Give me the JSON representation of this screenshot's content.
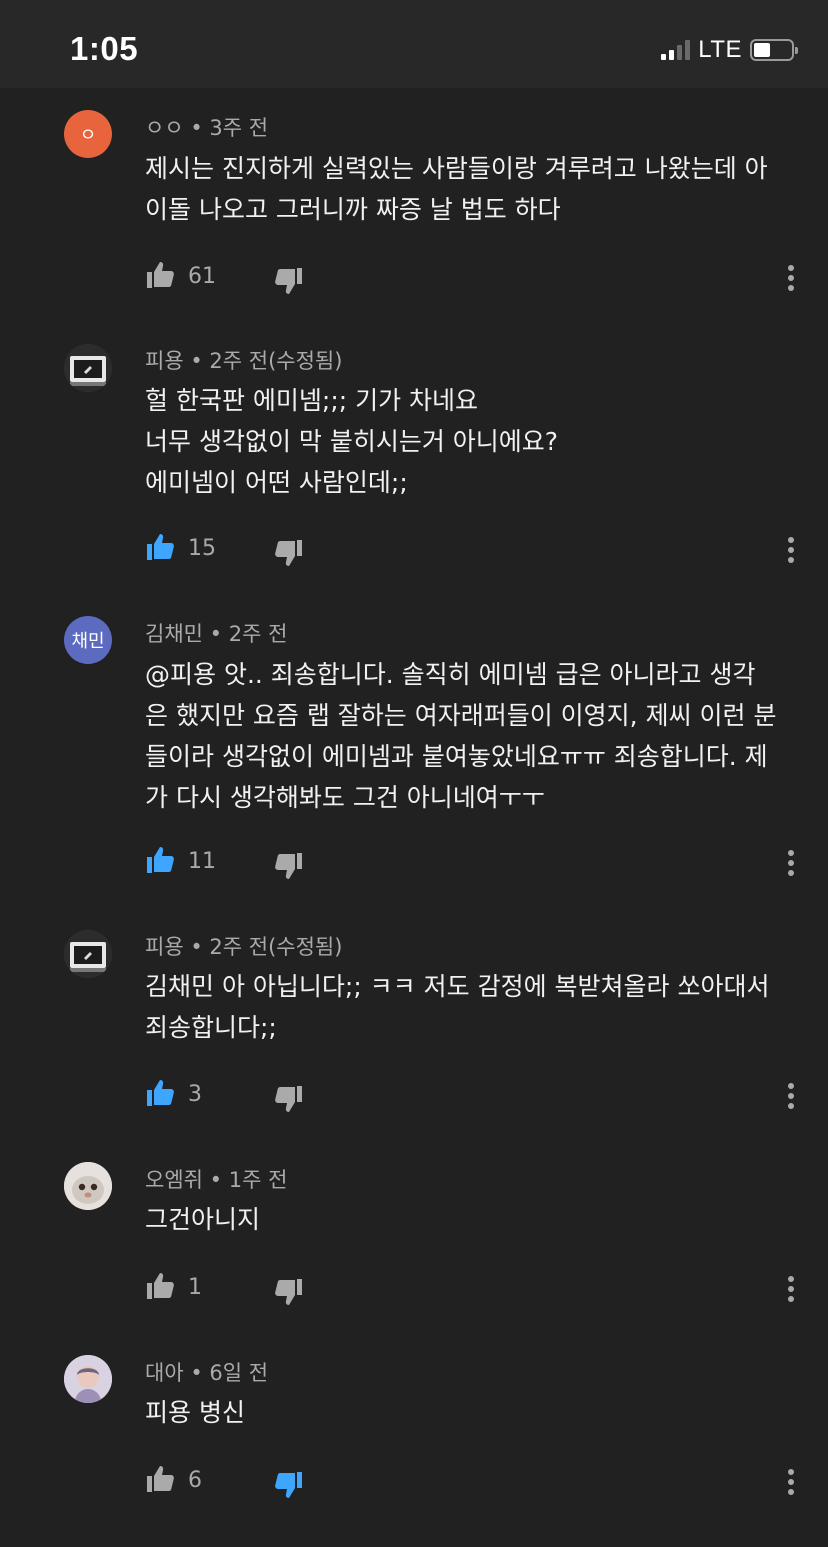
{
  "status": {
    "time": "1:05",
    "network": "LTE"
  },
  "comments": [
    {
      "author": "ㅇㅇ",
      "time": "3주 전",
      "edited": "",
      "avatar_text": "ㅇ",
      "avatar_color": "#e8643c",
      "lines": [
        "제시는 진지하게 실력있는 사람들이랑 겨루려고 나왔는데 아",
        "이돌 나오고 그러니까 짜증 날 법도 하다"
      ],
      "likes": "61",
      "liked": false,
      "disliked": false
    },
    {
      "author": "피용",
      "time": "2주 전",
      "edited": "(수정됨)",
      "avatar_text": "",
      "avatar_color": "#3a3a3a",
      "lines": [
        "헐 한국판 에미넴;;; 기가 차네요",
        "너무 생각없이 막 붙히시는거 아니에요?",
        "에미넴이 어떤 사람인데;;"
      ],
      "likes": "15",
      "liked": true,
      "disliked": false
    },
    {
      "author": "김채민",
      "time": "2주 전",
      "edited": "",
      "avatar_text": "채민",
      "avatar_color": "#5c6bc0",
      "lines": [
        "@피용 앗.. 죄송합니다. 솔직히 에미넴 급은 아니라고 생각",
        "은 했지만 요즘 랩 잘하는 여자래퍼들이 이영지, 제씨 이런 분",
        "들이라 생각없이 에미넴과 붙여놓았네요ㅠㅠ 죄송합니다. 제",
        "가 다시 생각해봐도 그건 아니네여ㅜㅜ"
      ],
      "likes": "11",
      "liked": true,
      "disliked": false
    },
    {
      "author": "피용",
      "time": "2주 전",
      "edited": "(수정됨)",
      "avatar_text": "",
      "avatar_color": "#3a3a3a",
      "lines": [
        "김채민 아 아닙니다;; ㅋㅋ 저도 감정에 복받쳐올라 쏘아대서",
        "죄송합니다;;"
      ],
      "likes": "3",
      "liked": true,
      "disliked": false
    },
    {
      "author": "오엠쥐",
      "time": "1주 전",
      "edited": "",
      "avatar_text": "",
      "avatar_color": "#d9d4cf",
      "lines": [
        "그건아니지"
      ],
      "likes": "1",
      "liked": false,
      "disliked": false
    },
    {
      "author": "대아",
      "time": "6일 전",
      "edited": "",
      "avatar_text": "",
      "avatar_color": "#c9c2d6",
      "lines": [
        "피용 병신"
      ],
      "likes": "6",
      "liked": false,
      "disliked": true
    }
  ],
  "colors": {
    "active": "#3ea6ff",
    "inactive": "#aaaaaa",
    "background": "#212121"
  },
  "icons": {
    "like": "thumbs-up-icon",
    "dislike": "thumbs-down-icon",
    "more": "more-vert-icon"
  }
}
